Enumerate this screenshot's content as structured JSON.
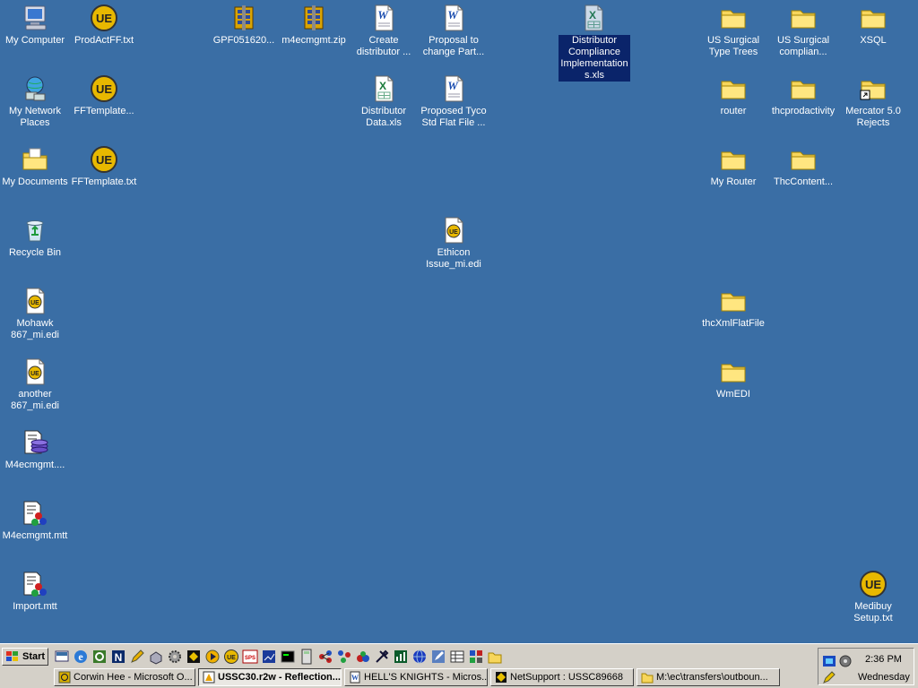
{
  "desktop_icons": [
    {
      "label": "My Computer",
      "icon": "my-computer-icon"
    },
    {
      "label": "ProdActFF.txt",
      "icon": "ultraedit-icon"
    },
    {
      "label": "GPF051620...",
      "icon": "zip-archive-icon"
    },
    {
      "label": "m4ecmgmt.zip",
      "icon": "zip-archive-icon"
    },
    {
      "label": "Create distributor ...",
      "icon": "word-document-icon"
    },
    {
      "label": "Proposal to change Part...",
      "icon": "word-document-icon"
    },
    {
      "label": "Distributor Compliance Implementations.xls",
      "icon": "excel-document-icon",
      "selected": true
    },
    {
      "label": "US Surgical Type Trees",
      "icon": "folder-icon"
    },
    {
      "label": "US Surgical complian...",
      "icon": "folder-icon"
    },
    {
      "label": "XSQL",
      "icon": "folder-icon"
    },
    {
      "label": "My Network Places",
      "icon": "network-places-icon"
    },
    {
      "label": "FFTemplate...",
      "icon": "ultraedit-icon"
    },
    {
      "label": "Distributor Data.xls",
      "icon": "excel-document-icon"
    },
    {
      "label": "Proposed Tyco Std Flat File ...",
      "icon": "word-document-icon"
    },
    {
      "label": "router",
      "icon": "folder-icon"
    },
    {
      "label": "thcprodactivity",
      "icon": "folder-icon"
    },
    {
      "label": "Mercator 5.0 Rejects",
      "icon": "folder-shortcut-icon"
    },
    {
      "label": "My Documents",
      "icon": "my-documents-icon"
    },
    {
      "label": "FFTemplate.txt",
      "icon": "ultraedit-icon"
    },
    {
      "label": "My Router",
      "icon": "folder-icon"
    },
    {
      "label": "ThcContent...",
      "icon": "folder-icon"
    },
    {
      "label": "Recycle Bin",
      "icon": "recycle-bin-icon"
    },
    {
      "label": "Ethicon Issue_mi.edi",
      "icon": "edi-document-icon"
    },
    {
      "label": "Mohawk 867_mi.edi",
      "icon": "edi-document-icon"
    },
    {
      "label": "thcXmlFlatFile",
      "icon": "folder-icon"
    },
    {
      "label": "another 867_mi.edi",
      "icon": "edi-document-icon"
    },
    {
      "label": "WmEDI",
      "icon": "folder-icon"
    },
    {
      "label": "M4ecmgmt....",
      "icon": "mercator-map-icon"
    },
    {
      "label": "M4ecmgmt.mtt",
      "icon": "mercator-tree-icon"
    },
    {
      "label": "Import.mtt",
      "icon": "mercator-tree-icon"
    },
    {
      "label": "Medibuy Setup.txt",
      "icon": "ultraedit-icon"
    }
  ],
  "taskbar": {
    "start_label": "Start",
    "quick_launch": [
      "show-desktop-icon",
      "internet-explorer-icon",
      "quicken-icon",
      "netscape-icon",
      "pencil-icon",
      "printer-icon",
      "gear-icon",
      "media-icon",
      "media-player-icon",
      "ultraedit-icon",
      "spss-icon",
      "analysis-icon",
      "terminal-icon",
      "calculator-icon",
      "network-icon",
      "molecule-icon",
      "molecule-icon",
      "tools-icon",
      "chart-icon",
      "globe-icon",
      "edit-icon",
      "grid-icon",
      "dashboard-icon",
      "folder-icon"
    ],
    "tasks": [
      {
        "label": "Corwin Hee - Microsoft O...",
        "icon": "outlook-icon"
      },
      {
        "label": "USSC30.r2w - Reflection...",
        "icon": "reflection-icon",
        "active": true
      },
      {
        "label": "HELL'S KNIGHTS - Micros...",
        "icon": "word-document-icon"
      },
      {
        "label": "NetSupport : USSC89668",
        "icon": "netsupport-icon"
      },
      {
        "label": "M:\\ec\\transfers\\outboun...",
        "icon": "folder-icon"
      }
    ],
    "tray": {
      "time": "2:36 PM",
      "day": "Wednesday",
      "icons": [
        "network-tray-icon",
        "speaker-icon",
        "pen-tray-icon"
      ]
    }
  },
  "colors": {
    "desktop": "#3a6ea5",
    "taskbar": "#d4d0c8",
    "selection": "#0a246a"
  }
}
